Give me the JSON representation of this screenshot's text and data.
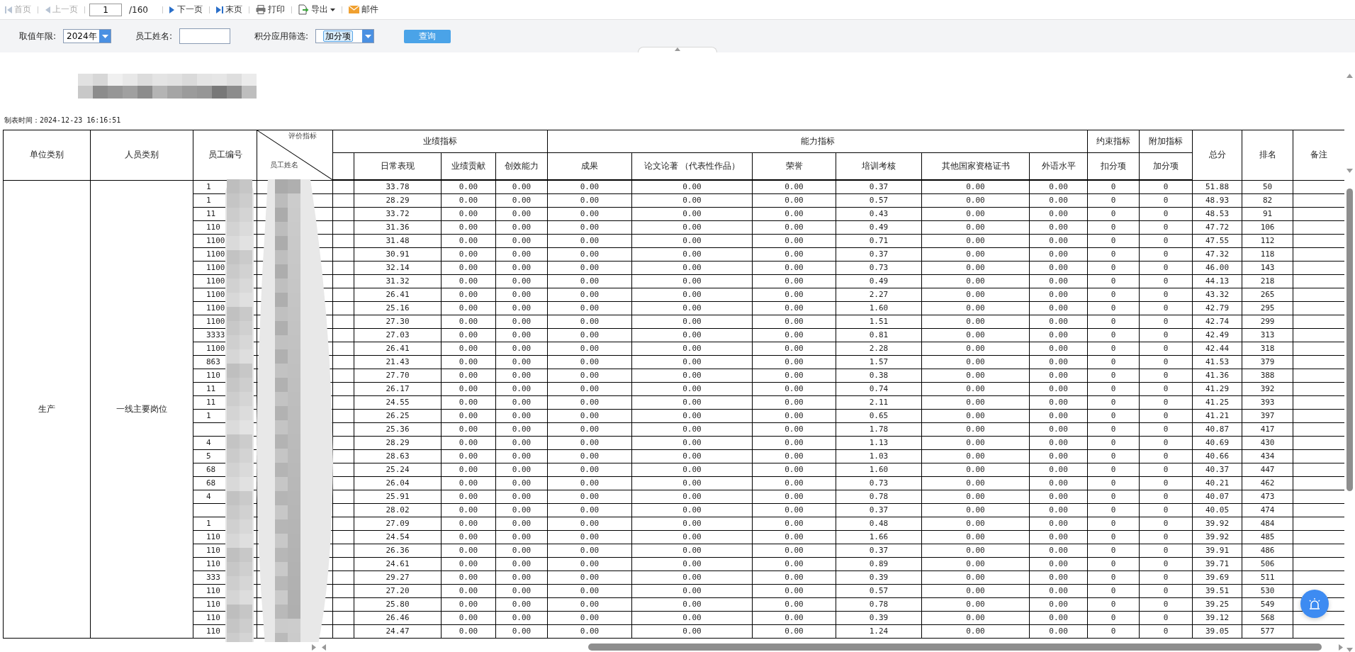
{
  "toolbar": {
    "items": [
      {
        "kind": "first",
        "label": "首页",
        "disabled": true
      },
      {
        "kind": "prev",
        "label": "上一页",
        "disabled": true
      },
      {
        "kind": "page",
        "value": "1",
        "total": "/160"
      },
      {
        "kind": "next",
        "label": "下一页",
        "disabled": false
      },
      {
        "kind": "last",
        "label": "末页",
        "disabled": false
      },
      {
        "kind": "print",
        "label": "打印",
        "disabled": false
      },
      {
        "kind": "export",
        "label": "导出",
        "disabled": false
      },
      {
        "kind": "mail",
        "label": "邮件",
        "disabled": false
      }
    ]
  },
  "filters": [
    {
      "kind": "select",
      "label": "取值年限:",
      "value": "2024年"
    },
    {
      "kind": "text",
      "label": "员工姓名:"
    },
    {
      "kind": "tags",
      "label": "积分应用筛选:",
      "tags": [
        "加分项"
      ]
    }
  ],
  "query_button": "查询",
  "report": {
    "created": "制表时间：2024-12-23 16:16:51",
    "table": {
      "header": {
        "unit_type": "单位类别",
        "staff_type": "人员类别",
        "employee_id": "员工编号",
        "diagonal_top": "评价指标",
        "diagonal_bottom": "员工姓名",
        "groups": [
          {
            "label": "业绩指标",
            "blank_column": true,
            "columns": [
              "日常表现",
              "业绩贡献",
              "创效能力"
            ]
          },
          {
            "label": "能力指标",
            "blank_column": false,
            "columns": [
              "成果",
              "论文论著 （代表性作品）",
              "荣誉",
              "培训考核",
              "其他国家资格证书",
              "外语水平"
            ]
          },
          {
            "label": "约束指标",
            "blank_column": false,
            "columns": [
              "扣分项"
            ]
          },
          {
            "label": "附加指标",
            "blank_column": false,
            "columns": [
              "加分项"
            ]
          }
        ],
        "tail_columns": [
          "总分",
          "排名",
          "备注"
        ]
      },
      "unit": "生产",
      "staff": "一线主要岗位",
      "rows": [
        {
          "id": "1",
          "values": [
            "33.78",
            "0.00",
            "0.00",
            "0.00",
            "0.00",
            "0.00",
            "0.37",
            "0.00",
            "0.00",
            "0",
            "0",
            "51.88",
            "50"
          ]
        },
        {
          "id": "1",
          "values": [
            "28.29",
            "0.00",
            "0.00",
            "0.00",
            "0.00",
            "0.00",
            "0.57",
            "0.00",
            "0.00",
            "0",
            "0",
            "48.93",
            "82"
          ]
        },
        {
          "id": "11",
          "values": [
            "33.72",
            "0.00",
            "0.00",
            "0.00",
            "0.00",
            "0.00",
            "0.43",
            "0.00",
            "0.00",
            "0",
            "0",
            "48.53",
            "91"
          ]
        },
        {
          "id": "110",
          "values": [
            "31.36",
            "0.00",
            "0.00",
            "0.00",
            "0.00",
            "0.00",
            "0.49",
            "0.00",
            "0.00",
            "0",
            "0",
            "47.72",
            "106"
          ]
        },
        {
          "id": "1100",
          "values": [
            "31.48",
            "0.00",
            "0.00",
            "0.00",
            "0.00",
            "0.00",
            "0.71",
            "0.00",
            "0.00",
            "0",
            "0",
            "47.55",
            "112"
          ]
        },
        {
          "id": "1100",
          "values": [
            "30.91",
            "0.00",
            "0.00",
            "0.00",
            "0.00",
            "0.00",
            "0.37",
            "0.00",
            "0.00",
            "0",
            "0",
            "47.32",
            "118"
          ]
        },
        {
          "id": "1100",
          "values": [
            "32.14",
            "0.00",
            "0.00",
            "0.00",
            "0.00",
            "0.00",
            "0.73",
            "0.00",
            "0.00",
            "0",
            "0",
            "46.00",
            "143"
          ]
        },
        {
          "id": "1100",
          "values": [
            "31.32",
            "0.00",
            "0.00",
            "0.00",
            "0.00",
            "0.00",
            "0.49",
            "0.00",
            "0.00",
            "0",
            "0",
            "44.13",
            "218"
          ]
        },
        {
          "id": "1100",
          "values": [
            "26.41",
            "0.00",
            "0.00",
            "0.00",
            "0.00",
            "0.00",
            "2.27",
            "0.00",
            "0.00",
            "0",
            "0",
            "43.32",
            "265"
          ]
        },
        {
          "id": "1100",
          "values": [
            "25.16",
            "0.00",
            "0.00",
            "0.00",
            "0.00",
            "0.00",
            "1.60",
            "0.00",
            "0.00",
            "0",
            "0",
            "42.79",
            "295"
          ]
        },
        {
          "id": "1100",
          "values": [
            "27.30",
            "0.00",
            "0.00",
            "0.00",
            "0.00",
            "0.00",
            "1.51",
            "0.00",
            "0.00",
            "0",
            "0",
            "42.74",
            "299"
          ]
        },
        {
          "id": "3333",
          "values": [
            "27.03",
            "0.00",
            "0.00",
            "0.00",
            "0.00",
            "0.00",
            "0.81",
            "0.00",
            "0.00",
            "0",
            "0",
            "42.49",
            "313"
          ]
        },
        {
          "id": "1100",
          "values": [
            "26.41",
            "0.00",
            "0.00",
            "0.00",
            "0.00",
            "0.00",
            "2.28",
            "0.00",
            "0.00",
            "0",
            "0",
            "42.44",
            "318"
          ]
        },
        {
          "id": "863",
          "values": [
            "21.43",
            "0.00",
            "0.00",
            "0.00",
            "0.00",
            "0.00",
            "1.57",
            "0.00",
            "0.00",
            "0",
            "0",
            "41.53",
            "379"
          ]
        },
        {
          "id": "110",
          "values": [
            "27.70",
            "0.00",
            "0.00",
            "0.00",
            "0.00",
            "0.00",
            "0.38",
            "0.00",
            "0.00",
            "0",
            "0",
            "41.36",
            "388"
          ]
        },
        {
          "id": "11",
          "values": [
            "26.17",
            "0.00",
            "0.00",
            "0.00",
            "0.00",
            "0.00",
            "0.74",
            "0.00",
            "0.00",
            "0",
            "0",
            "41.29",
            "392"
          ]
        },
        {
          "id": "11",
          "values": [
            "24.55",
            "0.00",
            "0.00",
            "0.00",
            "0.00",
            "0.00",
            "2.11",
            "0.00",
            "0.00",
            "0",
            "0",
            "41.25",
            "393"
          ]
        },
        {
          "id": "1",
          "values": [
            "26.25",
            "0.00",
            "0.00",
            "0.00",
            "0.00",
            "0.00",
            "0.65",
            "0.00",
            "0.00",
            "0",
            "0",
            "41.21",
            "397"
          ]
        },
        {
          "values": [
            "25.36",
            "0.00",
            "0.00",
            "0.00",
            "0.00",
            "0.00",
            "1.78",
            "0.00",
            "0.00",
            "0",
            "0",
            "40.87",
            "417"
          ]
        },
        {
          "id": "4",
          "values": [
            "28.29",
            "0.00",
            "0.00",
            "0.00",
            "0.00",
            "0.00",
            "1.13",
            "0.00",
            "0.00",
            "0",
            "0",
            "40.69",
            "430"
          ]
        },
        {
          "id": "5",
          "values": [
            "28.63",
            "0.00",
            "0.00",
            "0.00",
            "0.00",
            "0.00",
            "1.03",
            "0.00",
            "0.00",
            "0",
            "0",
            "40.66",
            "434"
          ]
        },
        {
          "id": "68",
          "values": [
            "25.24",
            "0.00",
            "0.00",
            "0.00",
            "0.00",
            "0.00",
            "1.60",
            "0.00",
            "0.00",
            "0",
            "0",
            "40.37",
            "447"
          ]
        },
        {
          "id": "68",
          "values": [
            "26.04",
            "0.00",
            "0.00",
            "0.00",
            "0.00",
            "0.00",
            "0.73",
            "0.00",
            "0.00",
            "0",
            "0",
            "40.21",
            "462"
          ]
        },
        {
          "id": "4",
          "values": [
            "25.91",
            "0.00",
            "0.00",
            "0.00",
            "0.00",
            "0.00",
            "0.78",
            "0.00",
            "0.00",
            "0",
            "0",
            "40.07",
            "473"
          ]
        },
        {
          "values": [
            "28.02",
            "0.00",
            "0.00",
            "0.00",
            "0.00",
            "0.00",
            "0.37",
            "0.00",
            "0.00",
            "0",
            "0",
            "40.05",
            "474"
          ]
        },
        {
          "id": "1",
          "values": [
            "27.09",
            "0.00",
            "0.00",
            "0.00",
            "0.00",
            "0.00",
            "0.48",
            "0.00",
            "0.00",
            "0",
            "0",
            "39.92",
            "484"
          ]
        },
        {
          "id": "110",
          "values": [
            "24.54",
            "0.00",
            "0.00",
            "0.00",
            "0.00",
            "0.00",
            "1.66",
            "0.00",
            "0.00",
            "0",
            "0",
            "39.92",
            "485"
          ]
        },
        {
          "id": "110",
          "values": [
            "26.36",
            "0.00",
            "0.00",
            "0.00",
            "0.00",
            "0.00",
            "0.37",
            "0.00",
            "0.00",
            "0",
            "0",
            "39.91",
            "486"
          ]
        },
        {
          "id": "110",
          "values": [
            "24.61",
            "0.00",
            "0.00",
            "0.00",
            "0.00",
            "0.00",
            "0.89",
            "0.00",
            "0.00",
            "0",
            "0",
            "39.71",
            "506"
          ]
        },
        {
          "id": "333",
          "values": [
            "29.27",
            "0.00",
            "0.00",
            "0.00",
            "0.00",
            "0.00",
            "0.39",
            "0.00",
            "0.00",
            "0",
            "0",
            "39.69",
            "511"
          ]
        },
        {
          "id": "110",
          "values": [
            "27.20",
            "0.00",
            "0.00",
            "0.00",
            "0.00",
            "0.00",
            "0.57",
            "0.00",
            "0.00",
            "0",
            "0",
            "39.51",
            "530"
          ]
        },
        {
          "id": "110",
          "values": [
            "25.80",
            "0.00",
            "0.00",
            "0.00",
            "0.00",
            "0.00",
            "0.78",
            "0.00",
            "0.00",
            "0",
            "0",
            "39.25",
            "549"
          ]
        },
        {
          "id": "110",
          "values": [
            "26.46",
            "0.00",
            "0.00",
            "0.00",
            "0.00",
            "0.00",
            "0.39",
            "0.00",
            "0.00",
            "0",
            "0",
            "39.12",
            "568"
          ]
        },
        {
          "id": "110",
          "values": [
            "24.47",
            "0.00",
            "0.00",
            "0.00",
            "0.00",
            "0.00",
            "1.24",
            "0.00",
            "0.00",
            "0",
            "0",
            "39.05",
            "577"
          ]
        }
      ]
    }
  }
}
